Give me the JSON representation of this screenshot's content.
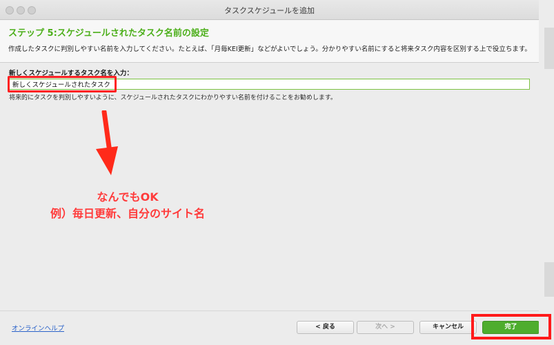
{
  "window": {
    "title": "タスクスケジュールを追加"
  },
  "header": {
    "step_title": "ステップ 5:スケジュールされたタスク名前の設定",
    "description": "作成したタスクに判別しやすい名前を入力してください。たとえば、「月毎KEI更新」などがよいでしょう。分かりやすい名前にすると将来タスク内容を区別する上で役立ちます。"
  },
  "form": {
    "label": "新しくスケジュールするタスク名を入力：",
    "task_name_value": "新しくスケジュールされたタスク",
    "hint": "将来的にタスクを判別しやすいように、スケジュールされたタスクにわかりやすい名前を付けることをお勧めします。"
  },
  "annotation": {
    "line1": "なんでもOK",
    "line2": "例）毎日更新、自分のサイト名",
    "color": "#ff3b3b"
  },
  "footer": {
    "help_link": "オンラインヘルプ",
    "back_label": "< 戻る",
    "next_label": "次へ >",
    "cancel_label": "キャンセル",
    "finish_label": "完了"
  },
  "colors": {
    "accent_green": "#4caf1a",
    "finish_button": "#4ead2d",
    "highlight_red": "#ff1a1a",
    "link_blue": "#2a62c9"
  }
}
